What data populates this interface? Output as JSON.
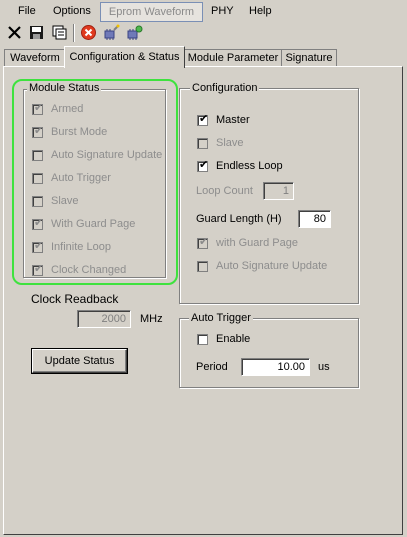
{
  "menu": {
    "file": "File",
    "options": "Options",
    "eprom_waveform": "Eprom Waveform",
    "phy": "PHY",
    "help": "Help"
  },
  "toolbar": {
    "icons": [
      "close-x-icon",
      "save-icon",
      "copy-icon",
      "stop-icon",
      "chip-wand-icon",
      "chip-settings-icon"
    ]
  },
  "tabs": [
    "Waveform",
    "Configuration & Status",
    "Module Parameter",
    "Signature"
  ],
  "module_status": {
    "title": "Module Status",
    "items": [
      {
        "label": "Armed",
        "checked": true
      },
      {
        "label": "Burst Mode",
        "checked": true
      },
      {
        "label": "Auto Signature Update",
        "checked": false
      },
      {
        "label": "Auto Trigger",
        "checked": false
      },
      {
        "label": "Slave",
        "checked": false
      },
      {
        "label": "With Guard Page",
        "checked": true
      },
      {
        "label": "Infinite Loop",
        "checked": true
      },
      {
        "label": "Clock Changed",
        "checked": true
      }
    ]
  },
  "clock": {
    "label": "Clock Readback",
    "value": "2000",
    "unit": "MHz"
  },
  "update_button": "Update Status",
  "configuration": {
    "title": "Configuration",
    "master": {
      "label": "Master",
      "checked": true
    },
    "slave": {
      "label": "Slave",
      "checked": false
    },
    "endless_loop": {
      "label": "Endless Loop",
      "checked": true
    },
    "loop_count_label": "Loop Count",
    "loop_count_value": "1",
    "guard_length_label": "Guard Length (H)",
    "guard_length_value": "80",
    "with_guard_page": {
      "label": "with Guard Page",
      "checked": true
    },
    "auto_signature_update": {
      "label": "Auto Signature Update",
      "checked": false
    }
  },
  "auto_trigger": {
    "title": "Auto Trigger",
    "enable": {
      "label": "Enable",
      "checked": false
    },
    "period_label": "Period",
    "period_value": "10.00",
    "period_unit": "us"
  },
  "colors": {
    "highlight": "#3ee23e",
    "background": "#d4d0c8",
    "disabled_text": "#8d8d8d"
  }
}
